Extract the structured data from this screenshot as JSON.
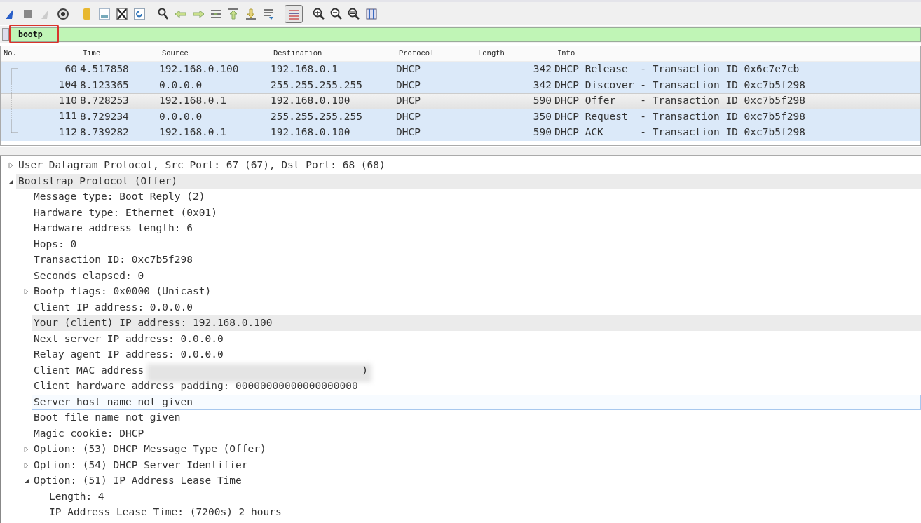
{
  "toolbar": [
    {
      "kind": "fin",
      "pressed": false
    },
    {
      "kind": "stop",
      "pressed": false
    },
    {
      "kind": "restart",
      "pressed": false
    },
    {
      "kind": "options",
      "pressed": false
    },
    {
      "kind": "open",
      "pressed": false
    },
    {
      "kind": "save",
      "pressed": false
    },
    {
      "kind": "close",
      "pressed": false
    },
    {
      "kind": "reload",
      "pressed": false
    },
    {
      "kind": "find",
      "pressed": false
    },
    {
      "kind": "back",
      "pressed": false
    },
    {
      "kind": "forward",
      "pressed": false
    },
    {
      "kind": "goto",
      "pressed": false
    },
    {
      "kind": "first",
      "pressed": false
    },
    {
      "kind": "last",
      "pressed": false
    },
    {
      "kind": "autoscroll",
      "pressed": false
    },
    {
      "kind": "colorize",
      "pressed": true
    },
    {
      "kind": "zoom-in",
      "pressed": false
    },
    {
      "kind": "zoom-out",
      "pressed": false
    },
    {
      "kind": "zoom-normal",
      "pressed": false
    },
    {
      "kind": "resize",
      "pressed": false
    }
  ],
  "filter": {
    "value": "bootp",
    "valid": true,
    "annotated": true
  },
  "packet_list": {
    "columns": [
      "No.",
      "Time",
      "Source",
      "Destination",
      "Protocol",
      "Length",
      "Info"
    ],
    "rows": [
      {
        "no": "60",
        "time": "4.517858",
        "source": "192.168.0.100",
        "destination": "192.168.0.1",
        "protocol": "DHCP",
        "length": "342",
        "info": "DHCP Release  - Transaction ID 0x6c7e7cb",
        "selected": false
      },
      {
        "no": "104",
        "time": "8.123365",
        "source": "0.0.0.0",
        "destination": "255.255.255.255",
        "protocol": "DHCP",
        "length": "342",
        "info": "DHCP Discover - Transaction ID 0xc7b5f298",
        "selected": false
      },
      {
        "no": "110",
        "time": "8.728253",
        "source": "192.168.0.1",
        "destination": "192.168.0.100",
        "protocol": "DHCP",
        "length": "590",
        "info": "DHCP Offer    - Transaction ID 0xc7b5f298",
        "selected": true
      },
      {
        "no": "111",
        "time": "8.729234",
        "source": "0.0.0.0",
        "destination": "255.255.255.255",
        "protocol": "DHCP",
        "length": "350",
        "info": "DHCP Request  - Transaction ID 0xc7b5f298",
        "selected": false
      },
      {
        "no": "112",
        "time": "8.739282",
        "source": "192.168.0.1",
        "destination": "192.168.0.100",
        "protocol": "DHCP",
        "length": "590",
        "info": "DHCP ACK      - Transaction ID 0xc7b5f298",
        "selected": false
      }
    ]
  },
  "details": [
    {
      "text": "User Datagram Protocol, Src Port: 67 (67), Dst Port: 68 (68)",
      "expanded": false,
      "selected": false
    },
    {
      "text": "Bootstrap Protocol (Offer)",
      "expanded": true,
      "selected": true,
      "children": [
        {
          "text": "Message type: Boot Reply (2)",
          "selected": false
        },
        {
          "text": "Hardware type: Ethernet (0x01)",
          "selected": false
        },
        {
          "text": "Hardware address length: 6",
          "selected": false
        },
        {
          "text": "Hops: 0",
          "selected": false
        },
        {
          "text": "Transaction ID: 0xc7b5f298",
          "selected": false
        },
        {
          "text": "Seconds elapsed: 0",
          "selected": false
        },
        {
          "text": "Bootp flags: 0x0000 (Unicast)",
          "expanded": false,
          "selected": false
        },
        {
          "text": "Client IP address: 0.0.0.0",
          "selected": false
        },
        {
          "text": "Your (client) IP address: 192.168.0.100",
          "selected": true
        },
        {
          "text": "Next server IP address: 0.0.0.0",
          "selected": false
        },
        {
          "text": "Relay agent IP address: 0.0.0.0",
          "selected": false
        },
        {
          "text": "Client MAC address",
          "redacted": true,
          "tail": ")",
          "selected": false
        },
        {
          "text": "Client hardware address padding: 00000000000000000000",
          "selected": false
        },
        {
          "text": "Server host name not given",
          "selected": false,
          "hovered": true
        },
        {
          "text": "Boot file name not given",
          "selected": false
        },
        {
          "text": "Magic cookie: DHCP",
          "selected": false
        },
        {
          "text": "Option: (53) DHCP Message Type (Offer)",
          "expanded": false,
          "selected": false
        },
        {
          "text": "Option: (54) DHCP Server Identifier",
          "expanded": false,
          "selected": false
        },
        {
          "text": "Option: (51) IP Address Lease Time",
          "expanded": true,
          "selected": false,
          "children": [
            {
              "text": "Length: 4",
              "selected": false
            },
            {
              "text": "IP Address Lease Time: (7200s) 2 hours",
              "selected": false
            }
          ]
        }
      ]
    }
  ]
}
